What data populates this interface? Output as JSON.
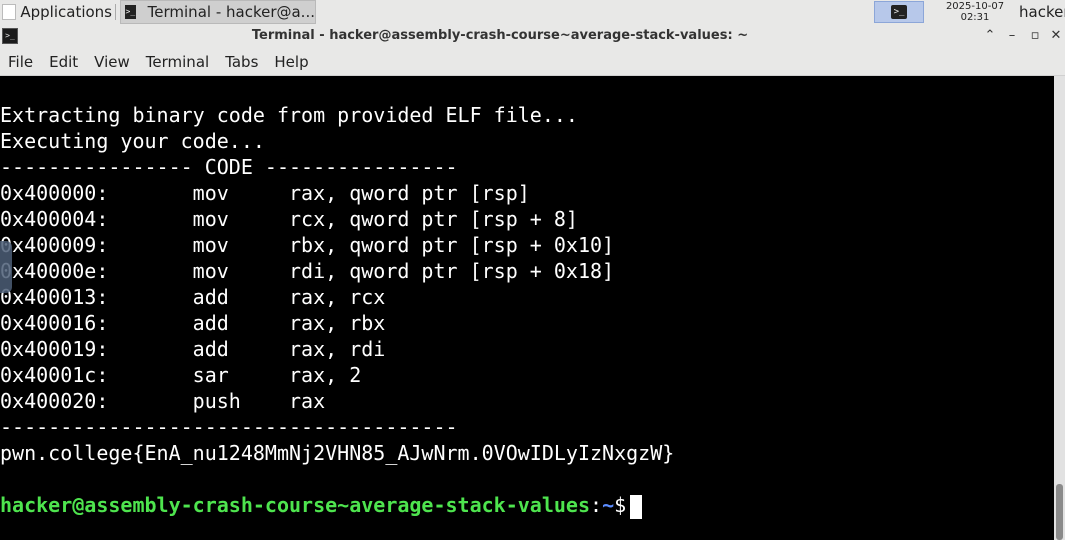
{
  "panel": {
    "applications_label": "Applications",
    "task_label": "Terminal - hacker@a...",
    "date": "2025-10-07",
    "time": "02:31",
    "user": "hacker"
  },
  "window": {
    "title": "Terminal - hacker@assembly-crash-course~average-stack-values: ~",
    "buttons": {
      "collapse": "⌃",
      "minimize": "–",
      "maximize": "▫",
      "close": "✕"
    }
  },
  "menubar": {
    "items": [
      "File",
      "Edit",
      "View",
      "Terminal",
      "Tabs",
      "Help"
    ]
  },
  "terminal": {
    "lines": [
      "Extracting binary code from provided ELF file...",
      "Executing your code...",
      "---------------- CODE ----------------",
      "0x400000:       mov     rax, qword ptr [rsp]",
      "0x400004:       mov     rcx, qword ptr [rsp + 8]",
      "0x400009:       mov     rbx, qword ptr [rsp + 0x10]",
      "0x40000e:       mov     rdi, qword ptr [rsp + 0x18]",
      "0x400013:       add     rax, rcx",
      "0x400016:       add     rax, rbx",
      "0x400019:       add     rax, rdi",
      "0x40001c:       sar     rax, 2",
      "0x400020:       push    rax",
      "--------------------------------------",
      "pwn.college{EnA_nu1248MmNj2VHN85_AJwNrm.0VOwIDLyIzNxgzW}"
    ],
    "prompt_user": "hacker@assembly-crash-course~average-stack-values",
    "prompt_colon": ":",
    "prompt_path": "~",
    "prompt_symbol": "$"
  },
  "colors": {
    "prompt_user": "#4ee44e",
    "prompt_path": "#5b8cff",
    "background": "#000000",
    "text": "#ffffff"
  }
}
